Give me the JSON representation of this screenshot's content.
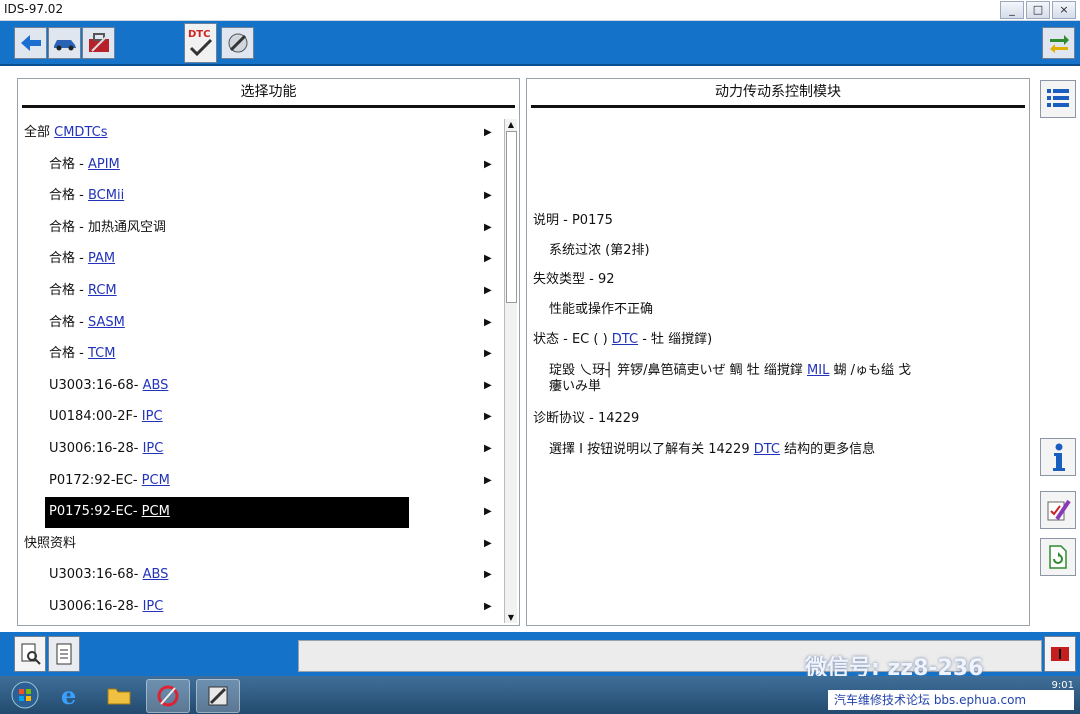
{
  "window": {
    "title": "IDS-97.02"
  },
  "window_controls": [
    "_",
    "□",
    "×"
  ],
  "left_panel": {
    "title": "选择功能",
    "rows": [
      {
        "level": 0,
        "prefix": "全部 ",
        "link": "CMDTCs"
      },
      {
        "level": 1,
        "prefix": "合格 - ",
        "link": "APIM"
      },
      {
        "level": 1,
        "prefix": "合格 - ",
        "link": "BCMii"
      },
      {
        "level": 1,
        "prefix": "合格 - 加热通风空调",
        "link": ""
      },
      {
        "level": 1,
        "prefix": "合格 - ",
        "link": "PAM"
      },
      {
        "level": 1,
        "prefix": "合格 - ",
        "link": "RCM"
      },
      {
        "level": 1,
        "prefix": "合格 - ",
        "link": "SASM"
      },
      {
        "level": 1,
        "prefix": "合格 - ",
        "link": "TCM"
      },
      {
        "level": 1,
        "prefix": "U3003:16-68- ",
        "link": "ABS"
      },
      {
        "level": 1,
        "prefix": "U0184:00-2F- ",
        "link": "IPC"
      },
      {
        "level": 1,
        "prefix": "U3006:16-28- ",
        "link": "IPC"
      },
      {
        "level": 1,
        "prefix": "P0172:92-EC- ",
        "link": "PCM"
      },
      {
        "level": 1,
        "prefix": "P0175:92-EC- ",
        "link": "PCM",
        "selected": true
      },
      {
        "level": 0,
        "prefix": "快照资料",
        "link": ""
      },
      {
        "level": 1,
        "prefix": "U3003:16-68- ",
        "link": "ABS"
      },
      {
        "level": 1,
        "prefix": "U3006:16-28- ",
        "link": "IPC"
      }
    ]
  },
  "right_panel": {
    "title": "动力传动系控制模块",
    "lines": [
      {
        "indent": false,
        "parts": [
          {
            "t": "说明 - P0175"
          }
        ]
      },
      {
        "indent": true,
        "parts": [
          {
            "t": "系统过浓 (第2排)"
          }
        ]
      },
      {
        "indent": false,
        "parts": [
          {
            "t": "失效类型 - 92"
          }
        ]
      },
      {
        "indent": true,
        "parts": [
          {
            "t": "性能或操作不正确"
          }
        ]
      },
      {
        "indent": false,
        "parts": [
          {
            "t": "状态 - EC (   )  "
          },
          {
            "t": "DTC",
            "link": true
          },
          {
            "t": " - 牡   缁撹鐣)"
          }
        ]
      },
      {
        "indent": true,
        "parts": [
          {
            "t": "琔毀   乀玡┤      笄锣/鼻笆碻吏いぜ   鲷   牡   缁撹鐣   "
          },
          {
            "t": "MIL",
            "link": true
          },
          {
            "t": "   蝴   /ゅも缢   戈"
          }
        ]
      },
      {
        "indent": true,
        "parts": [
          {
            "t": "瘻いみ単"
          }
        ]
      },
      {
        "indent": false,
        "parts": [
          {
            "t": "诊断协议 - 14229"
          }
        ]
      },
      {
        "indent": true,
        "parts": [
          {
            "t": "選擇 I 按钮说明以了解有关 14229 "
          },
          {
            "t": "DTC",
            "link": true
          },
          {
            "t": " 结构的更多信息"
          }
        ]
      }
    ]
  },
  "watermark": "微信号: zz8-236",
  "forum": "汽车维修技术论坛  bbs.ephua.com",
  "tray_time": "9:01"
}
